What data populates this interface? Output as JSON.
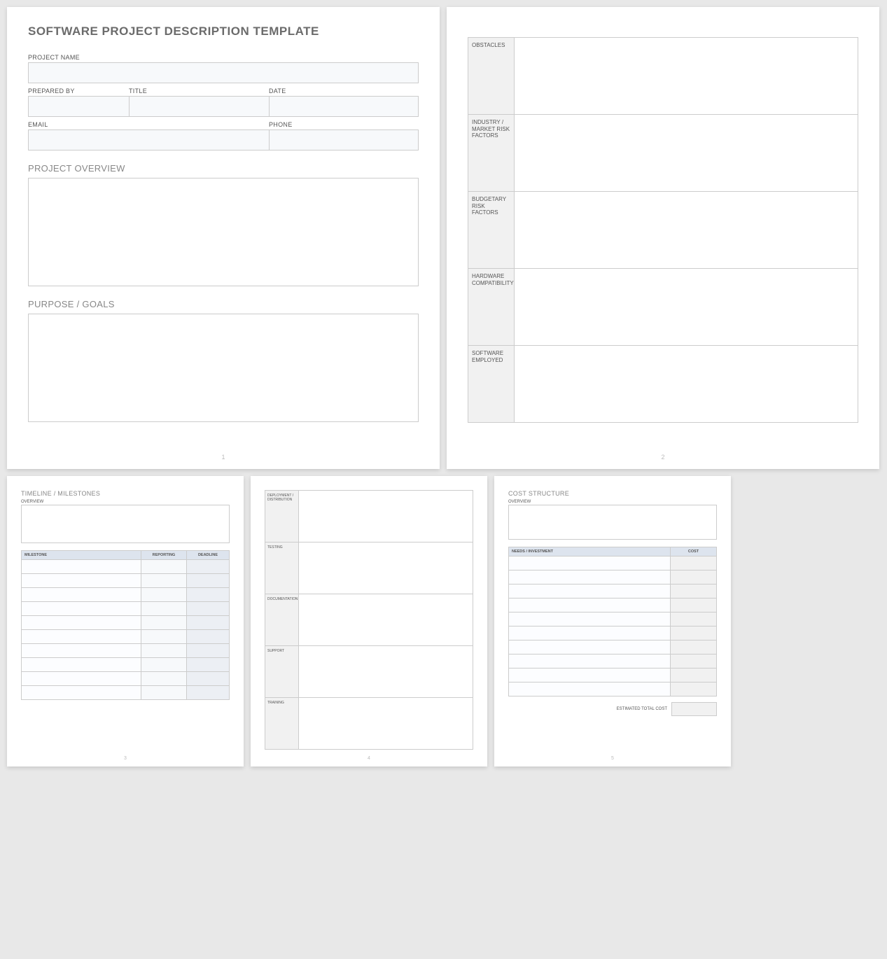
{
  "page1": {
    "title": "SOFTWARE PROJECT DESCRIPTION TEMPLATE",
    "project_name_label": "PROJECT NAME",
    "prepared_by_label": "PREPARED BY",
    "title_label": "TITLE",
    "date_label": "DATE",
    "email_label": "EMAIL",
    "phone_label": "PHONE",
    "overview_title": "PROJECT OVERVIEW",
    "purpose_title": "PURPOSE / GOALS",
    "page_num": "1"
  },
  "page2": {
    "rows": [
      "OBSTACLES",
      "INDUSTRY / MARKET RISK FACTORS",
      "BUDGETARY RISK FACTORS",
      "HARDWARE COMPATIBILITY",
      "SOFTWARE EMPLOYED"
    ],
    "page_num": "2"
  },
  "page3": {
    "title": "TIMELINE / MILESTONES",
    "overview_label": "OVERVIEW",
    "headers": [
      "MILESTONE",
      "REPORTING",
      "DEADLINE"
    ],
    "row_count": 10,
    "page_num": "3"
  },
  "page4": {
    "rows": [
      "DEPLOYMENT / DISTRIBUTION",
      "TESTING",
      "DOCUMENTATION",
      "SUPPORT",
      "TRAINING"
    ],
    "page_num": "4"
  },
  "page5": {
    "title": "COST STRUCTURE",
    "overview_label": "OVERVIEW",
    "headers": [
      "NEEDS / INVESTMENT",
      "COST"
    ],
    "row_count": 10,
    "total_label": "ESTIMATED TOTAL COST",
    "page_num": "5"
  }
}
